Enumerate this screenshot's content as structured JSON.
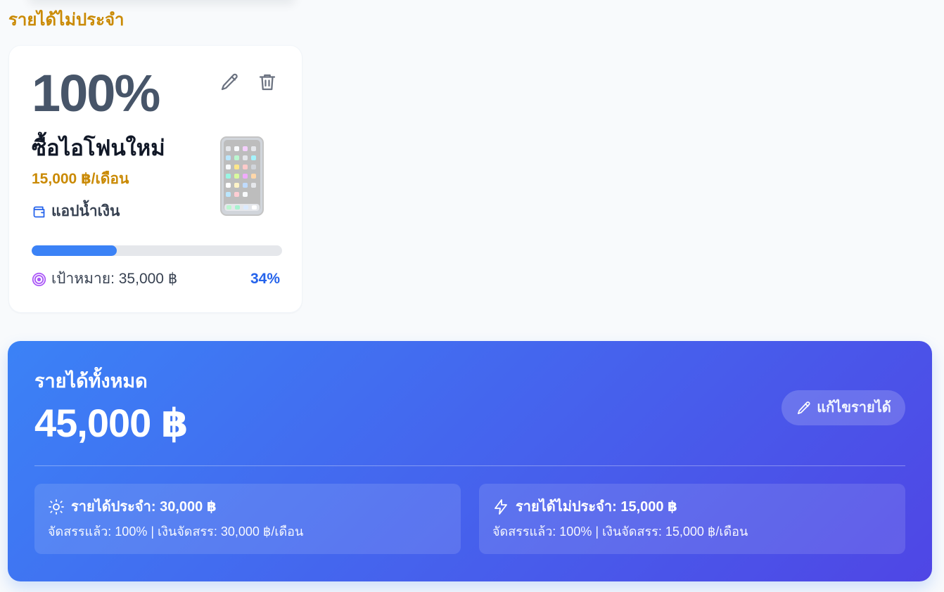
{
  "irregular_income": {
    "heading": "รายได้ไม่ประจำ",
    "goal_card": {
      "percent": "100%",
      "name": "ซื้อไอโฟนใหม่",
      "amount": "15,000 ฿/เดือน",
      "source": "แอปน้ำเงิน",
      "target": "เป้าหมาย: 35,000 ฿",
      "progress_percent": "34%",
      "progress_fraction": 0.34,
      "icons": {
        "edit": "pencil-icon",
        "delete": "trash-icon",
        "source": "wallet-icon",
        "target": "target-icon",
        "image": "phone-icon"
      }
    }
  },
  "income_summary": {
    "label": "รายได้ทั้งหมด",
    "total": "45,000 ฿",
    "edit_button": "แก้ไขรายได้",
    "regular": {
      "label": "รายได้ประจำ: 30,000 ฿",
      "detail": "จัดสรรแล้ว: 100% | เงินจัดสรร: 30,000 ฿/เดือน",
      "icon": "sun-icon"
    },
    "irregular": {
      "label": "รายได้ไม่ประจำ: 15,000 ฿",
      "detail": "จัดสรรแล้ว: 100% | เงินจัดสรร: 15,000 ฿/เดือน",
      "icon": "lightning-icon"
    }
  },
  "colors": {
    "section_heading": "#ca8a04",
    "progress_fill": "#3b82f6",
    "progress_percent": "#2563eb",
    "gradient_start": "#3b82f6",
    "gradient_end": "#4f46e5"
  }
}
